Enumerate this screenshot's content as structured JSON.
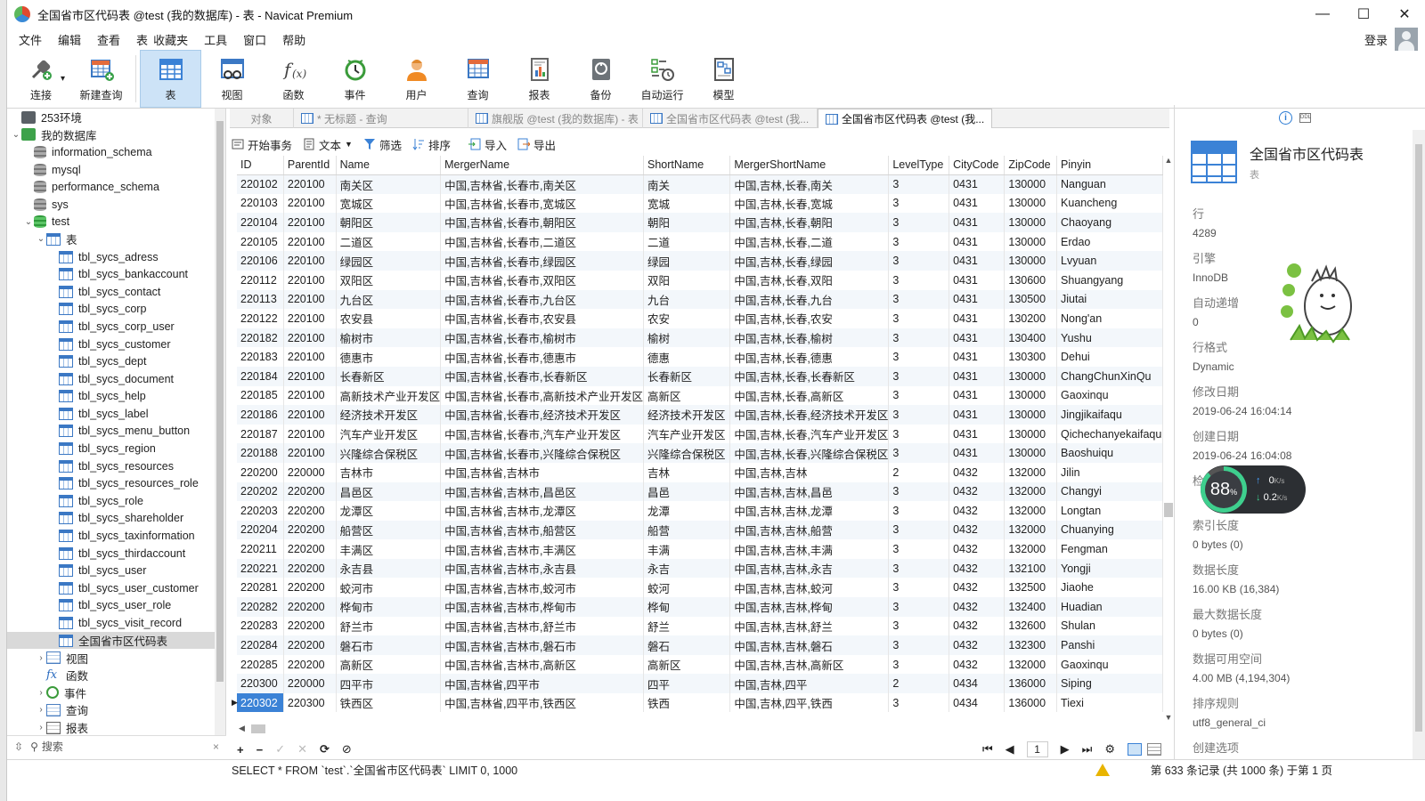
{
  "window": {
    "title": "全国省市区代码表 @test (我的数据库) - 表 - Navicat Premium",
    "minimize": "—",
    "maximize": "☐",
    "close": "✕"
  },
  "menu": [
    "文件",
    "编辑",
    "查看",
    "表",
    "收藏夹",
    "工具",
    "窗口",
    "帮助"
  ],
  "login": "登录",
  "ribbon": [
    {
      "label": "连接",
      "icon": "connect-icon"
    },
    {
      "label": "新建查询",
      "icon": "new-query-icon"
    },
    {
      "label": "表",
      "icon": "table-icon",
      "active": true
    },
    {
      "label": "视图",
      "icon": "view-icon"
    },
    {
      "label": "函数",
      "icon": "function-icon"
    },
    {
      "label": "事件",
      "icon": "event-icon"
    },
    {
      "label": "用户",
      "icon": "user-icon"
    },
    {
      "label": "查询",
      "icon": "query-icon"
    },
    {
      "label": "报表",
      "icon": "report-icon"
    },
    {
      "label": "备份",
      "icon": "backup-icon"
    },
    {
      "label": "自动运行",
      "icon": "automation-icon"
    },
    {
      "label": "模型",
      "icon": "model-icon"
    }
  ],
  "tree": [
    {
      "label": "253环境",
      "level": 0,
      "icon": "conn",
      "twisty": ""
    },
    {
      "label": "我的数据库",
      "level": 0,
      "icon": "conng",
      "twisty": "⌄"
    },
    {
      "label": "information_schema",
      "level": 1,
      "icon": "db",
      "twisty": ""
    },
    {
      "label": "mysql",
      "level": 1,
      "icon": "db",
      "twisty": ""
    },
    {
      "label": "performance_schema",
      "level": 1,
      "icon": "db",
      "twisty": ""
    },
    {
      "label": "sys",
      "level": 1,
      "icon": "db",
      "twisty": ""
    },
    {
      "label": "test",
      "level": 1,
      "icon": "dbg",
      "twisty": "⌄"
    },
    {
      "label": "表",
      "level": 2,
      "icon": "tbl",
      "twisty": "⌄"
    },
    {
      "label": "tbl_sycs_adress",
      "level": 3,
      "icon": "tbl",
      "twisty": ""
    },
    {
      "label": "tbl_sycs_bankaccount",
      "level": 3,
      "icon": "tbl",
      "twisty": ""
    },
    {
      "label": "tbl_sycs_contact",
      "level": 3,
      "icon": "tbl",
      "twisty": ""
    },
    {
      "label": "tbl_sycs_corp",
      "level": 3,
      "icon": "tbl",
      "twisty": ""
    },
    {
      "label": "tbl_sycs_corp_user",
      "level": 3,
      "icon": "tbl",
      "twisty": ""
    },
    {
      "label": "tbl_sycs_customer",
      "level": 3,
      "icon": "tbl",
      "twisty": ""
    },
    {
      "label": "tbl_sycs_dept",
      "level": 3,
      "icon": "tbl",
      "twisty": ""
    },
    {
      "label": "tbl_sycs_document",
      "level": 3,
      "icon": "tbl",
      "twisty": ""
    },
    {
      "label": "tbl_sycs_help",
      "level": 3,
      "icon": "tbl",
      "twisty": ""
    },
    {
      "label": "tbl_sycs_label",
      "level": 3,
      "icon": "tbl",
      "twisty": ""
    },
    {
      "label": "tbl_sycs_menu_button",
      "level": 3,
      "icon": "tbl",
      "twisty": ""
    },
    {
      "label": "tbl_sycs_region",
      "level": 3,
      "icon": "tbl",
      "twisty": ""
    },
    {
      "label": "tbl_sycs_resources",
      "level": 3,
      "icon": "tbl",
      "twisty": ""
    },
    {
      "label": "tbl_sycs_resources_role",
      "level": 3,
      "icon": "tbl",
      "twisty": ""
    },
    {
      "label": "tbl_sycs_role",
      "level": 3,
      "icon": "tbl",
      "twisty": ""
    },
    {
      "label": "tbl_sycs_shareholder",
      "level": 3,
      "icon": "tbl",
      "twisty": ""
    },
    {
      "label": "tbl_sycs_taxinformation",
      "level": 3,
      "icon": "tbl",
      "twisty": ""
    },
    {
      "label": "tbl_sycs_thirdaccount",
      "level": 3,
      "icon": "tbl",
      "twisty": ""
    },
    {
      "label": "tbl_sycs_user",
      "level": 3,
      "icon": "tbl",
      "twisty": ""
    },
    {
      "label": "tbl_sycs_user_customer",
      "level": 3,
      "icon": "tbl",
      "twisty": ""
    },
    {
      "label": "tbl_sycs_user_role",
      "level": 3,
      "icon": "tbl",
      "twisty": ""
    },
    {
      "label": "tbl_sycs_visit_record",
      "level": 3,
      "icon": "tbl",
      "twisty": ""
    },
    {
      "label": "全国省市区代码表",
      "level": 3,
      "icon": "tbl",
      "twisty": "",
      "selected": true
    },
    {
      "label": "视图",
      "level": 2,
      "icon": "qry",
      "twisty": "›"
    },
    {
      "label": "函数",
      "level": 2,
      "icon": "func",
      "twisty": ""
    },
    {
      "label": "事件",
      "level": 2,
      "icon": "evt",
      "twisty": "›"
    },
    {
      "label": "查询",
      "level": 2,
      "icon": "qry",
      "twisty": "›"
    },
    {
      "label": "报表",
      "level": 2,
      "icon": "rpt",
      "twisty": "›"
    }
  ],
  "tree_search": {
    "placeholder": "搜索",
    "clear": "×"
  },
  "tabs": [
    {
      "label": "对象",
      "icon": false
    },
    {
      "label": "* 无标题 - 查询",
      "icon": true
    },
    {
      "label": "旗舰版 @test (我的数据库) - 表",
      "icon": true
    },
    {
      "label": "全国省市区代码表 @test (我...",
      "icon": true
    },
    {
      "label": "全国省市区代码表 @test (我...",
      "icon": true,
      "active": true
    }
  ],
  "grid_toolbar": {
    "begin_tx": "开始事务",
    "text": "文本",
    "filter": "筛选",
    "sort": "排序",
    "import": "导入",
    "export": "导出"
  },
  "columns": [
    "ID",
    "ParentId",
    "Name",
    "MergerName",
    "ShortName",
    "MergerShortName",
    "LevelType",
    "CityCode",
    "ZipCode",
    "Pinyin"
  ],
  "rows": [
    [
      "220102",
      "220100",
      "南关区",
      "中国,吉林省,长春市,南关区",
      "南关",
      "中国,吉林,长春,南关",
      "3",
      "0431",
      "130000",
      "Nanguan"
    ],
    [
      "220103",
      "220100",
      "宽城区",
      "中国,吉林省,长春市,宽城区",
      "宽城",
      "中国,吉林,长春,宽城",
      "3",
      "0431",
      "130000",
      "Kuancheng"
    ],
    [
      "220104",
      "220100",
      "朝阳区",
      "中国,吉林省,长春市,朝阳区",
      "朝阳",
      "中国,吉林,长春,朝阳",
      "3",
      "0431",
      "130000",
      "Chaoyang"
    ],
    [
      "220105",
      "220100",
      "二道区",
      "中国,吉林省,长春市,二道区",
      "二道",
      "中国,吉林,长春,二道",
      "3",
      "0431",
      "130000",
      "Erdao"
    ],
    [
      "220106",
      "220100",
      "绿园区",
      "中国,吉林省,长春市,绿园区",
      "绿园",
      "中国,吉林,长春,绿园",
      "3",
      "0431",
      "130000",
      "Lvyuan"
    ],
    [
      "220112",
      "220100",
      "双阳区",
      "中国,吉林省,长春市,双阳区",
      "双阳",
      "中国,吉林,长春,双阳",
      "3",
      "0431",
      "130600",
      "Shuangyang"
    ],
    [
      "220113",
      "220100",
      "九台区",
      "中国,吉林省,长春市,九台区",
      "九台",
      "中国,吉林,长春,九台",
      "3",
      "0431",
      "130500",
      "Jiutai"
    ],
    [
      "220122",
      "220100",
      "农安县",
      "中国,吉林省,长春市,农安县",
      "农安",
      "中国,吉林,长春,农安",
      "3",
      "0431",
      "130200",
      "Nong'an"
    ],
    [
      "220182",
      "220100",
      "榆树市",
      "中国,吉林省,长春市,榆树市",
      "榆树",
      "中国,吉林,长春,榆树",
      "3",
      "0431",
      "130400",
      "Yushu"
    ],
    [
      "220183",
      "220100",
      "德惠市",
      "中国,吉林省,长春市,德惠市",
      "德惠",
      "中国,吉林,长春,德惠",
      "3",
      "0431",
      "130300",
      "Dehui"
    ],
    [
      "220184",
      "220100",
      "长春新区",
      "中国,吉林省,长春市,长春新区",
      "长春新区",
      "中国,吉林,长春,长春新区",
      "3",
      "0431",
      "130000",
      "ChangChunXinQu"
    ],
    [
      "220185",
      "220100",
      "高新技术产业开发区",
      "中国,吉林省,长春市,高新技术产业开发区",
      "高新区",
      "中国,吉林,长春,高新区",
      "3",
      "0431",
      "130000",
      "Gaoxinqu"
    ],
    [
      "220186",
      "220100",
      "经济技术开发区",
      "中国,吉林省,长春市,经济技术开发区",
      "经济技术开发区",
      "中国,吉林,长春,经济技术开发区",
      "3",
      "0431",
      "130000",
      "Jingjikaifaqu"
    ],
    [
      "220187",
      "220100",
      "汽车产业开发区",
      "中国,吉林省,长春市,汽车产业开发区",
      "汽车产业开发区",
      "中国,吉林,长春,汽车产业开发区",
      "3",
      "0431",
      "130000",
      "Qichechanyekaifaqu"
    ],
    [
      "220188",
      "220100",
      "兴隆综合保税区",
      "中国,吉林省,长春市,兴隆综合保税区",
      "兴隆综合保税区",
      "中国,吉林,长春,兴隆综合保税区",
      "3",
      "0431",
      "130000",
      "Baoshuiqu"
    ],
    [
      "220200",
      "220000",
      "吉林市",
      "中国,吉林省,吉林市",
      "吉林",
      "中国,吉林,吉林",
      "2",
      "0432",
      "132000",
      "Jilin"
    ],
    [
      "220202",
      "220200",
      "昌邑区",
      "中国,吉林省,吉林市,昌邑区",
      "昌邑",
      "中国,吉林,吉林,昌邑",
      "3",
      "0432",
      "132000",
      "Changyi"
    ],
    [
      "220203",
      "220200",
      "龙潭区",
      "中国,吉林省,吉林市,龙潭区",
      "龙潭",
      "中国,吉林,吉林,龙潭",
      "3",
      "0432",
      "132000",
      "Longtan"
    ],
    [
      "220204",
      "220200",
      "船营区",
      "中国,吉林省,吉林市,船营区",
      "船营",
      "中国,吉林,吉林,船营",
      "3",
      "0432",
      "132000",
      "Chuanying"
    ],
    [
      "220211",
      "220200",
      "丰满区",
      "中国,吉林省,吉林市,丰满区",
      "丰满",
      "中国,吉林,吉林,丰满",
      "3",
      "0432",
      "132000",
      "Fengman"
    ],
    [
      "220221",
      "220200",
      "永吉县",
      "中国,吉林省,吉林市,永吉县",
      "永吉",
      "中国,吉林,吉林,永吉",
      "3",
      "0432",
      "132100",
      "Yongji"
    ],
    [
      "220281",
      "220200",
      "蛟河市",
      "中国,吉林省,吉林市,蛟河市",
      "蛟河",
      "中国,吉林,吉林,蛟河",
      "3",
      "0432",
      "132500",
      "Jiaohe"
    ],
    [
      "220282",
      "220200",
      "桦甸市",
      "中国,吉林省,吉林市,桦甸市",
      "桦甸",
      "中国,吉林,吉林,桦甸",
      "3",
      "0432",
      "132400",
      "Huadian"
    ],
    [
      "220283",
      "220200",
      "舒兰市",
      "中国,吉林省,吉林市,舒兰市",
      "舒兰",
      "中国,吉林,吉林,舒兰",
      "3",
      "0432",
      "132600",
      "Shulan"
    ],
    [
      "220284",
      "220200",
      "磐石市",
      "中国,吉林省,吉林市,磐石市",
      "磐石",
      "中国,吉林,吉林,磐石",
      "3",
      "0432",
      "132300",
      "Panshi"
    ],
    [
      "220285",
      "220200",
      "高新区",
      "中国,吉林省,吉林市,高新区",
      "高新区",
      "中国,吉林,吉林,高新区",
      "3",
      "0432",
      "132000",
      "Gaoxinqu"
    ],
    [
      "220300",
      "220000",
      "四平市",
      "中国,吉林省,四平市",
      "四平",
      "中国,吉林,四平",
      "2",
      "0434",
      "136000",
      "Siping"
    ],
    [
      "220302",
      "220300",
      "铁西区",
      "中国,吉林省,四平市,铁西区",
      "铁西",
      "中国,吉林,四平,铁西",
      "3",
      "0434",
      "136000",
      "Tiexi"
    ]
  ],
  "current_row_index": 27,
  "nav": {
    "add": "+",
    "remove": "−",
    "apply": "✓",
    "cancel": "✕",
    "refresh": "⟳",
    "stop": "⊘",
    "first": "⏮",
    "prev": "◀",
    "page": "1",
    "next": "▶",
    "last": "⏭",
    "settings": "⚙"
  },
  "status": {
    "sql": "SELECT * FROM `test`.`全国省市区代码表` LIMIT 0, 1000",
    "record": "第 633 条记录 (共 1000 条) 于第 1 页"
  },
  "info": {
    "title": "全国省市区代码表",
    "subtitle": "表",
    "props": [
      {
        "label": "行",
        "value": "4289"
      },
      {
        "label": "引擎",
        "value": "InnoDB"
      },
      {
        "label": "自动递增",
        "value": "0"
      },
      {
        "label": "行格式",
        "value": "Dynamic"
      },
      {
        "label": "修改日期",
        "value": "2019-06-24 16:04:14"
      },
      {
        "label": "创建日期",
        "value": "2019-06-24 16:04:08"
      },
      {
        "label": "检查时间",
        "value": ""
      },
      {
        "label": "索引长度",
        "value": "0 bytes (0)"
      },
      {
        "label": "数据长度",
        "value": "16.00 KB (16,384)"
      },
      {
        "label": "最大数据长度",
        "value": "0 bytes (0)"
      },
      {
        "label": "数据可用空间",
        "value": "4.00 MB (4,194,304)"
      },
      {
        "label": "排序规则",
        "value": "utf8_general_ci"
      },
      {
        "label": "创建选项",
        "value": ""
      }
    ]
  },
  "speed": {
    "percent": "88",
    "percent_sign": "%",
    "up": "0",
    "down": "0.2",
    "unit": "K/s"
  }
}
